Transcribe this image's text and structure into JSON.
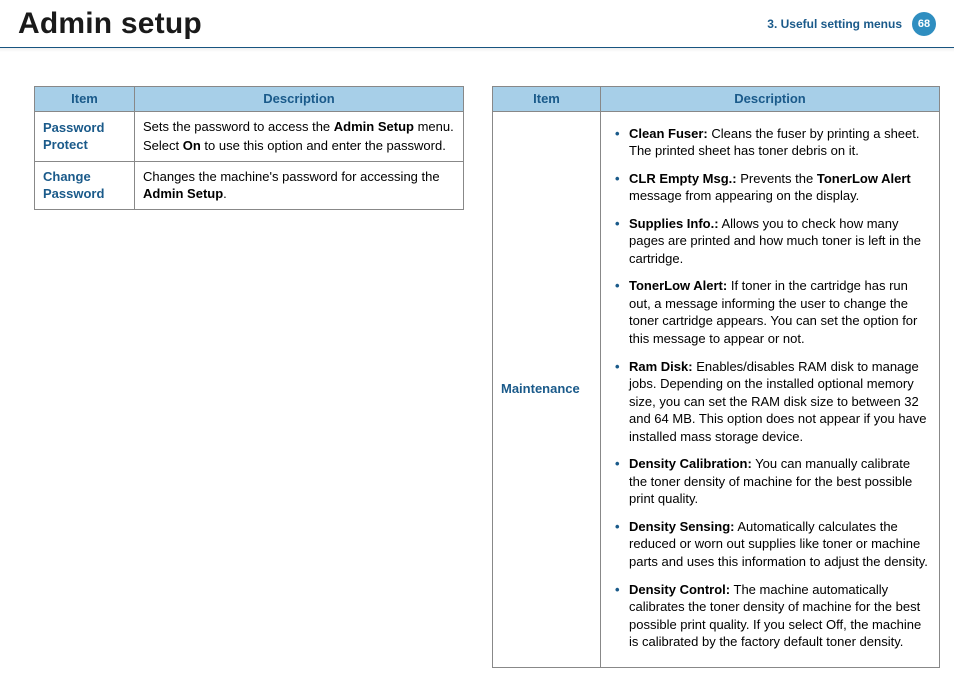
{
  "header": {
    "title": "Admin setup",
    "chapter": "3.  Useful setting menus",
    "page": "68"
  },
  "table1": {
    "head_item": "Item",
    "head_desc": "Description",
    "rows": [
      {
        "item": "Password Protect",
        "line1a": "Sets the password to access the ",
        "line1b": "Admin Setup",
        "line1c": " menu.",
        "line2a": "Select ",
        "line2b": "On",
        "line2c": " to use this option and enter the password."
      },
      {
        "item": "Change Password",
        "line1a": "Changes the machine's password for accessing the ",
        "line1b": "Admin Setup",
        "line1c": "."
      }
    ]
  },
  "table2": {
    "head_item": "Item",
    "head_desc": "Description",
    "row_item": "Maintenance",
    "bullets": [
      {
        "label": "Clean Fuser:",
        "text": " Cleans the fuser by printing a sheet. The printed sheet has toner debris on it."
      },
      {
        "label": "CLR Empty Msg.:",
        "text_a": " Prevents the ",
        "text_b": "TonerLow Alert",
        "text_c": " message from appearing on the display."
      },
      {
        "label": "Supplies Info.:",
        "text": " Allows you to check how many pages are printed and how much toner is left in the cartridge."
      },
      {
        "label": "TonerLow Alert:",
        "text": " If toner in the cartridge has run out, a message informing the user to change the toner cartridge appears. You can set the option for this message to appear or not."
      },
      {
        "label": "Ram Disk:",
        "text": " Enables/disables RAM disk to manage jobs. Depending on the installed optional memory size, you can set the RAM disk size to between 32 and 64 MB. This option does not appear if you have installed mass storage device."
      },
      {
        "label": "Density Calibration:",
        "text": " You can manually calibrate the toner density of machine for the best possible print quality."
      },
      {
        "label": "Density Sensing:",
        "text": " Automatically calculates the reduced or worn out supplies like toner or machine parts and uses this information to adjust the density."
      },
      {
        "label": "Density Control:",
        "text": " The machine automatically calibrates the toner density of machine for the best possible print quality. If you select Off, the machine is calibrated by the factory default toner density."
      }
    ]
  }
}
